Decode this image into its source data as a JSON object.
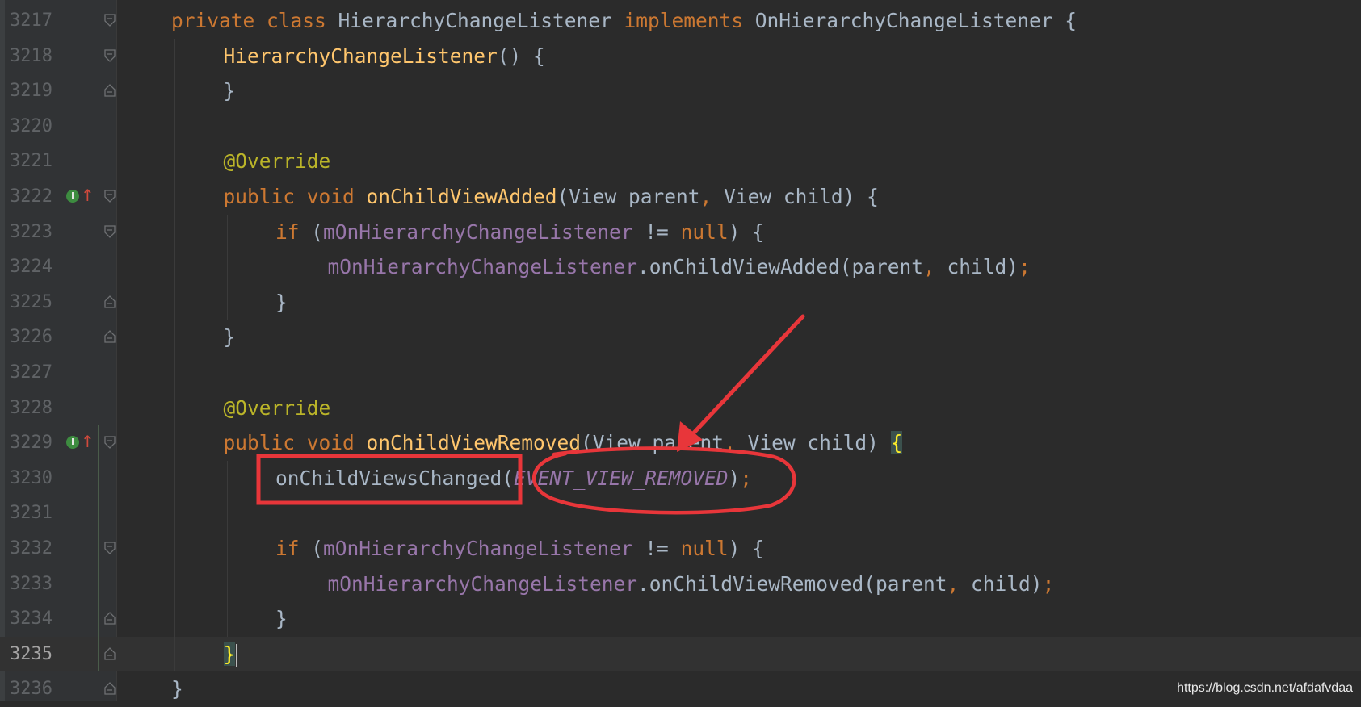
{
  "editor": {
    "lines": [
      {
        "num": "3217",
        "fold": "open",
        "segments": [
          {
            "t": "private class ",
            "c": "kw"
          },
          {
            "t": "HierarchyChangeListener ",
            "c": "cls"
          },
          {
            "t": "implements ",
            "c": "kw"
          },
          {
            "t": "OnHierarchyChangeListener {",
            "c": "cls"
          }
        ]
      },
      {
        "num": "3218",
        "fold": "open",
        "indent": 1,
        "segments": [
          {
            "t": "HierarchyChangeListener",
            "c": "fn"
          },
          {
            "t": "() {",
            "c": "cls"
          }
        ]
      },
      {
        "num": "3219",
        "fold": "close",
        "indent": 1,
        "segments": [
          {
            "t": "}",
            "c": "cls"
          }
        ]
      },
      {
        "num": "3220",
        "segments": []
      },
      {
        "num": "3221",
        "indent": 1,
        "segments": [
          {
            "t": "@Override",
            "c": "ann"
          }
        ]
      },
      {
        "num": "3222",
        "fold": "open",
        "marker": "implements-up",
        "indent": 1,
        "segments": [
          {
            "t": "public void ",
            "c": "kw"
          },
          {
            "t": "onChildViewAdded",
            "c": "fn"
          },
          {
            "t": "(View parent",
            "c": "cls"
          },
          {
            "t": ", ",
            "c": "kw"
          },
          {
            "t": "View child) {",
            "c": "cls"
          }
        ]
      },
      {
        "num": "3223",
        "fold": "open",
        "indent": 2,
        "segments": [
          {
            "t": "if ",
            "c": "kw"
          },
          {
            "t": "(",
            "c": "cls"
          },
          {
            "t": "mOnHierarchyChangeListener ",
            "c": "fld"
          },
          {
            "t": "!= ",
            "c": "cls"
          },
          {
            "t": "null",
            "c": "kw"
          },
          {
            "t": ") {",
            "c": "cls"
          }
        ]
      },
      {
        "num": "3224",
        "indent": 3,
        "segments": [
          {
            "t": "mOnHierarchyChangeListener",
            "c": "fld"
          },
          {
            "t": ".onChildViewAdded(parent",
            "c": "cls"
          },
          {
            "t": ", ",
            "c": "kw"
          },
          {
            "t": "child)",
            "c": "cls"
          },
          {
            "t": ";",
            "c": "kw"
          }
        ]
      },
      {
        "num": "3225",
        "fold": "close",
        "indent": 2,
        "segments": [
          {
            "t": "}",
            "c": "cls"
          }
        ]
      },
      {
        "num": "3226",
        "fold": "close",
        "indent": 1,
        "segments": [
          {
            "t": "}",
            "c": "cls"
          }
        ]
      },
      {
        "num": "3227",
        "segments": []
      },
      {
        "num": "3228",
        "indent": 1,
        "segments": [
          {
            "t": "@Override",
            "c": "ann"
          }
        ]
      },
      {
        "num": "3229",
        "fold": "open",
        "marker": "implements-up",
        "indent": 1,
        "segments": [
          {
            "t": "public void ",
            "c": "kw"
          },
          {
            "t": "onChildViewRemoved",
            "c": "fn"
          },
          {
            "t": "(View parent",
            "c": "cls"
          },
          {
            "t": ", ",
            "c": "kw"
          },
          {
            "t": "View child) ",
            "c": "cls"
          },
          {
            "t": "{",
            "c": "brace-hl"
          }
        ]
      },
      {
        "num": "3230",
        "indent": 2,
        "segments": [
          {
            "t": "onChildViewsChanged(",
            "c": "cls"
          },
          {
            "t": "EVENT_VIEW_REMOVED",
            "c": "const"
          },
          {
            "t": ")",
            "c": "cls"
          },
          {
            "t": ";",
            "c": "kw"
          }
        ]
      },
      {
        "num": "3231",
        "segments": []
      },
      {
        "num": "3232",
        "fold": "open",
        "indent": 2,
        "segments": [
          {
            "t": "if ",
            "c": "kw"
          },
          {
            "t": "(",
            "c": "cls"
          },
          {
            "t": "mOnHierarchyChangeListener ",
            "c": "fld"
          },
          {
            "t": "!= ",
            "c": "cls"
          },
          {
            "t": "null",
            "c": "kw"
          },
          {
            "t": ") {",
            "c": "cls"
          }
        ]
      },
      {
        "num": "3233",
        "indent": 3,
        "segments": [
          {
            "t": "mOnHierarchyChangeListener",
            "c": "fld"
          },
          {
            "t": ".onChildViewRemoved(parent",
            "c": "cls"
          },
          {
            "t": ", ",
            "c": "kw"
          },
          {
            "t": "child)",
            "c": "cls"
          },
          {
            "t": ";",
            "c": "kw"
          }
        ]
      },
      {
        "num": "3234",
        "fold": "close",
        "indent": 2,
        "segments": [
          {
            "t": "}",
            "c": "cls"
          }
        ]
      },
      {
        "num": "3235",
        "fold": "close",
        "current": true,
        "indent": 1,
        "segments": [
          {
            "t": "}",
            "c": "brace-hl"
          }
        ]
      },
      {
        "num": "3236",
        "fold": "close",
        "segments": [
          {
            "t": "}",
            "c": "cls"
          }
        ]
      }
    ]
  },
  "annotation_colors": {
    "marker": "#e8363a"
  },
  "watermark": "https://blog.csdn.net/afdafvdaa"
}
